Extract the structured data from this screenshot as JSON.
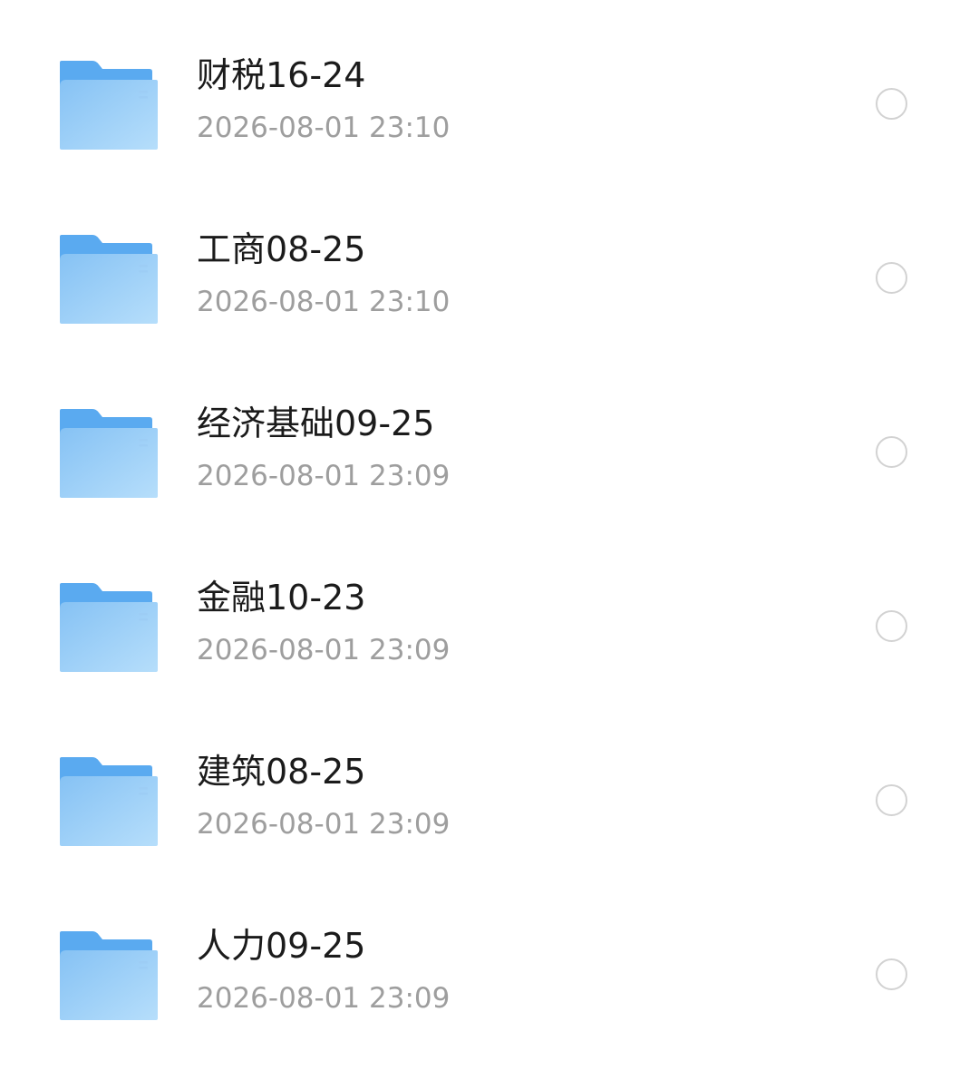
{
  "folders": [
    {
      "name": "财税16-24",
      "time": "2026-08-01 23:10",
      "selected": false
    },
    {
      "name": "工商08-25",
      "time": "2026-08-01 23:10",
      "selected": false
    },
    {
      "name": "经济基础09-25",
      "time": "2026-08-01 23:09",
      "selected": false
    },
    {
      "name": "金融10-23",
      "time": "2026-08-01 23:09",
      "selected": false
    },
    {
      "name": "建筑08-25",
      "time": "2026-08-01 23:09",
      "selected": false
    },
    {
      "name": "人力09-25",
      "time": "2026-08-01 23:09",
      "selected": false
    }
  ],
  "icons": {
    "folder": "folder-icon",
    "select": "radio-circle-icon"
  },
  "colors": {
    "folder_back": "#5aaaf0",
    "folder_front_top": "#8cc6f5",
    "folder_front_bottom": "#b4dcfb",
    "name_text": "#1b1b1b",
    "time_text": "#9e9e9e",
    "radio_border": "#d2d2d2"
  }
}
